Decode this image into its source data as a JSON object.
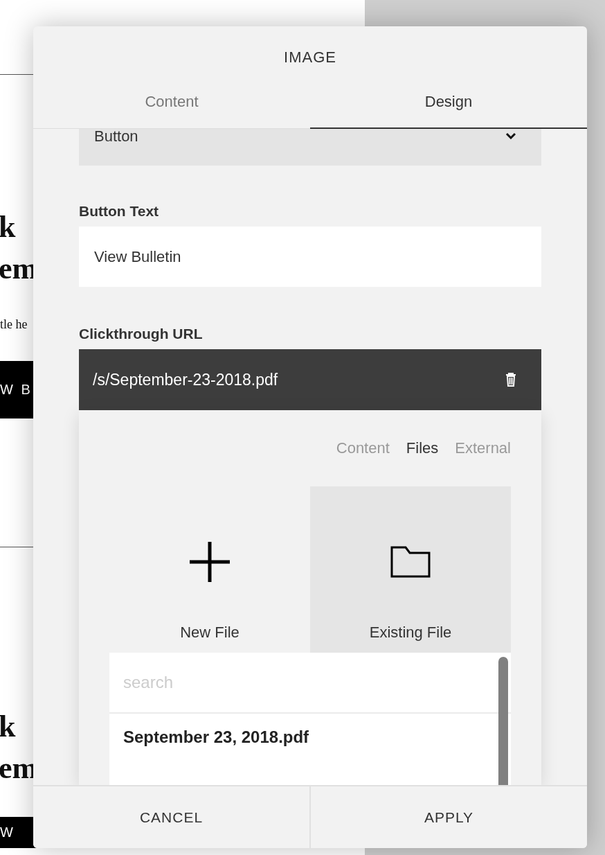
{
  "background_page": {
    "items": [
      {
        "kind": "rule"
      },
      {
        "kind": "heading",
        "text": "k"
      },
      {
        "kind": "heading",
        "text": "em"
      },
      {
        "kind": "text",
        "text": "tle he"
      },
      {
        "kind": "button",
        "text": "W B"
      },
      {
        "kind": "rule"
      },
      {
        "kind": "heading",
        "text": "k"
      },
      {
        "kind": "heading",
        "text": "em"
      },
      {
        "kind": "button",
        "text": "W"
      }
    ]
  },
  "dialog": {
    "title": "IMAGE",
    "tabs": [
      {
        "label": "Content",
        "selected": false
      },
      {
        "label": "Design",
        "selected": true
      }
    ],
    "style_select": {
      "value": "Button"
    },
    "button_text": {
      "label": "Button Text",
      "value": "View Bulletin"
    },
    "clickthrough": {
      "label": "Clickthrough URL",
      "value": "/s/September-23-2018.pdf",
      "link_tabs": [
        {
          "label": "Content",
          "selected": false
        },
        {
          "label": "Files",
          "selected": true
        },
        {
          "label": "External",
          "selected": false
        }
      ],
      "sources": [
        {
          "kind": "new",
          "label": "New File",
          "selected": false
        },
        {
          "kind": "existing",
          "label": "Existing File",
          "selected": true
        }
      ],
      "file_list": {
        "search": {
          "placeholder": "search"
        },
        "files": [
          {
            "name": "September 23, 2018.pdf"
          }
        ]
      }
    },
    "footer_buttons": [
      {
        "label": "CANCEL"
      },
      {
        "label": "APPLY"
      }
    ]
  }
}
